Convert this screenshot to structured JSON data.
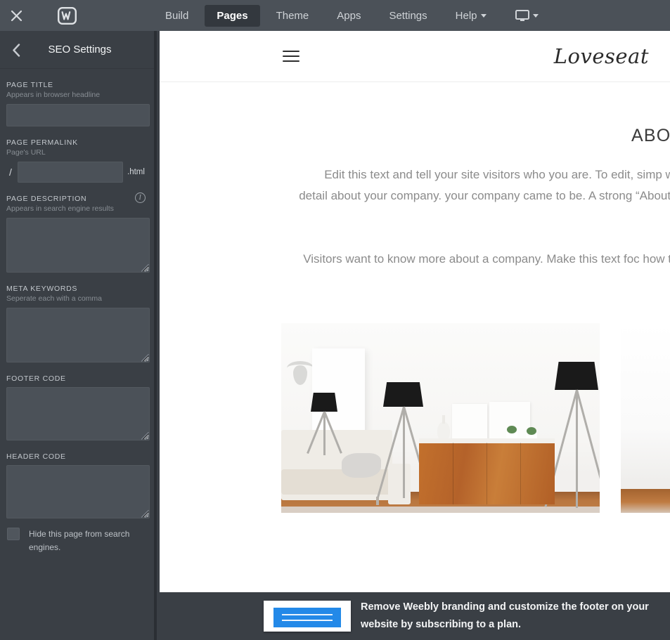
{
  "topbar": {
    "close_label": "close-icon",
    "logo_label": "Weebly",
    "items": [
      {
        "label": "Build",
        "active": false,
        "has_caret": false
      },
      {
        "label": "Pages",
        "active": true,
        "has_caret": false
      },
      {
        "label": "Theme",
        "active": false,
        "has_caret": false
      },
      {
        "label": "Apps",
        "active": false,
        "has_caret": false
      },
      {
        "label": "Settings",
        "active": false,
        "has_caret": false
      },
      {
        "label": "Help",
        "active": false,
        "has_caret": true
      }
    ],
    "device_label": "desktop-preview"
  },
  "sidebar": {
    "title": "SEO Settings",
    "back_label": "back",
    "fields": {
      "page_title": {
        "label": "PAGE TITLE",
        "sub": "Appears in browser headline",
        "value": "",
        "placeholder": ""
      },
      "page_permalink": {
        "label": "PAGE PERMALINK",
        "sub": "Page's URL",
        "prefix": "/",
        "suffix": ".html",
        "value": "",
        "placeholder": ""
      },
      "page_description": {
        "label": "PAGE DESCRIPTION",
        "sub": "Appears in search engine results",
        "info": "i",
        "value": "",
        "placeholder": ""
      },
      "meta_keywords": {
        "label": "META KEYWORDS",
        "sub": "Seperate each with a comma",
        "value": "",
        "placeholder": ""
      },
      "footer_code": {
        "label": "FOOTER CODE",
        "value": "",
        "placeholder": ""
      },
      "header_code": {
        "label": "HEADER CODE",
        "value": "",
        "placeholder": ""
      }
    },
    "hide_checkbox": {
      "label": "Hide this page from search engines.",
      "checked": false
    }
  },
  "preview": {
    "site_logo": "Loveseat",
    "menu_label": "menu",
    "heading": "ABOUT US",
    "paragraph_1": "Edit this text and tell your site visitors who you are. To edit, simp words. Use this text to go into more detail about your company. your company came to be. A strong “About” page helps establish visitor know more about",
    "paragraph_2": "Visitors want to know more about a company. Make this text foc how the company was started, what the team looks li",
    "image_1_alt": "Bright living room with tripod lamps and wooden sideboard",
    "image_2_alt": "Room interior with wooden floor"
  },
  "banner": {
    "thumb_alt": "site-footer-thumbnail",
    "message": "Remove Weebly branding and customize the footer on your website by subscribing to a plan."
  },
  "colors": {
    "topbar_bg": "#4b5158",
    "sidebar_bg": "#3a3f45",
    "active_tab_bg": "#33383e",
    "input_bg": "#4b5158",
    "banner_bg": "#3a3f45",
    "accent_blue": "#2389e8",
    "preview_bg": "#ffffff"
  }
}
